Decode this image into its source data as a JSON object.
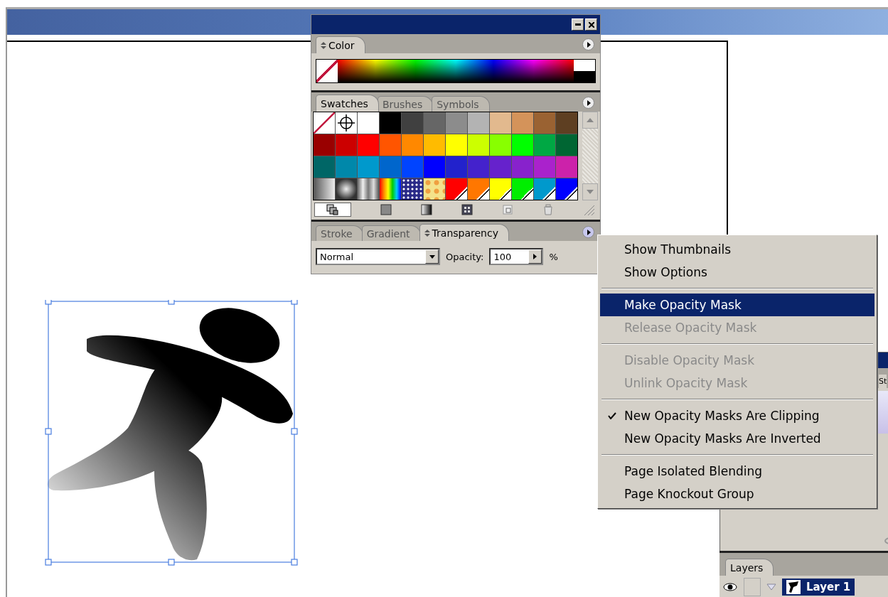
{
  "color_panel": {
    "tabs": [
      {
        "label": "Color",
        "selected": true
      }
    ]
  },
  "swatches_panel": {
    "tabs": [
      {
        "label": "Swatches",
        "selected": true
      },
      {
        "label": "Brushes",
        "selected": false
      },
      {
        "label": "Symbols",
        "selected": false
      }
    ],
    "rows": [
      [
        {
          "kind": "none"
        },
        {
          "kind": "registration"
        },
        {
          "kind": "solid",
          "color": "#ffffff"
        },
        {
          "kind": "solid",
          "color": "#000000"
        },
        {
          "kind": "solid",
          "color": "#404040"
        },
        {
          "kind": "solid",
          "color": "#666666"
        },
        {
          "kind": "solid",
          "color": "#8c8c8c"
        },
        {
          "kind": "solid",
          "color": "#b3b3b3"
        },
        {
          "kind": "solid",
          "color": "#e2b98e"
        },
        {
          "kind": "solid",
          "color": "#d4935a"
        },
        {
          "kind": "solid",
          "color": "#9a6232"
        },
        {
          "kind": "solid",
          "color": "#5e3f22"
        }
      ],
      [
        {
          "kind": "solid",
          "color": "#990000"
        },
        {
          "kind": "solid",
          "color": "#cc0000"
        },
        {
          "kind": "solid",
          "color": "#ff0000"
        },
        {
          "kind": "solid",
          "color": "#ff5500"
        },
        {
          "kind": "solid",
          "color": "#ff8800"
        },
        {
          "kind": "solid",
          "color": "#ffbb00"
        },
        {
          "kind": "solid",
          "color": "#ffff00"
        },
        {
          "kind": "solid",
          "color": "#ccff00"
        },
        {
          "kind": "solid",
          "color": "#88ff00"
        },
        {
          "kind": "solid",
          "color": "#00ff00"
        },
        {
          "kind": "solid",
          "color": "#00a844"
        },
        {
          "kind": "solid",
          "color": "#006633"
        }
      ],
      [
        {
          "kind": "solid",
          "color": "#006666"
        },
        {
          "kind": "solid",
          "color": "#0088aa"
        },
        {
          "kind": "solid",
          "color": "#0099cc"
        },
        {
          "kind": "solid",
          "color": "#0066cc"
        },
        {
          "kind": "solid",
          "color": "#0044ff"
        },
        {
          "kind": "solid",
          "color": "#0000ff"
        },
        {
          "kind": "solid",
          "color": "#2222cc"
        },
        {
          "kind": "solid",
          "color": "#4422cc"
        },
        {
          "kind": "solid",
          "color": "#6622cc"
        },
        {
          "kind": "solid",
          "color": "#8822cc"
        },
        {
          "kind": "solid",
          "color": "#aa22cc"
        },
        {
          "kind": "solid",
          "color": "#cc22aa"
        }
      ],
      [
        {
          "kind": "linear-gradient"
        },
        {
          "kind": "radial-gradient"
        },
        {
          "kind": "metal-gradient"
        },
        {
          "kind": "rainbow-gradient"
        },
        {
          "kind": "star-pattern"
        },
        {
          "kind": "tile-pattern"
        },
        {
          "kind": "spot",
          "color": "#ff0000"
        },
        {
          "kind": "spot",
          "color": "#ff7700"
        },
        {
          "kind": "spot",
          "color": "#ffff00"
        },
        {
          "kind": "spot",
          "color": "#00ee00"
        },
        {
          "kind": "spot",
          "color": "#0099cc"
        },
        {
          "kind": "spot",
          "color": "#0000ff"
        }
      ]
    ]
  },
  "transparency_panel": {
    "tabs": [
      {
        "label": "Stroke",
        "selected": false
      },
      {
        "label": "Gradient",
        "selected": false
      },
      {
        "label": "Transparency",
        "selected": true
      }
    ],
    "blend_mode": "Normal",
    "opacity_label": "Opacity:",
    "opacity": "100",
    "opacity_unit": "%"
  },
  "menu": {
    "sections": [
      [
        {
          "label": "Show Thumbnails",
          "disabled": false,
          "checked": false,
          "selected": false
        },
        {
          "label": "Show Options",
          "disabled": false,
          "checked": false,
          "selected": false
        }
      ],
      [
        {
          "label": "Make Opacity Mask",
          "disabled": false,
          "checked": false,
          "selected": true
        },
        {
          "label": "Release Opacity Mask",
          "disabled": true,
          "checked": false,
          "selected": false
        }
      ],
      [
        {
          "label": "Disable Opacity Mask",
          "disabled": true,
          "checked": false,
          "selected": false
        },
        {
          "label": "Unlink Opacity Mask",
          "disabled": true,
          "checked": false,
          "selected": false
        }
      ],
      [
        {
          "label": "New Opacity Masks Are Clipping",
          "disabled": false,
          "checked": true,
          "selected": false
        },
        {
          "label": "New Opacity Masks Are Inverted",
          "disabled": false,
          "checked": false,
          "selected": false
        }
      ],
      [
        {
          "label": "Page Isolated Blending",
          "disabled": false,
          "checked": false,
          "selected": false
        },
        {
          "label": "Page Knockout Group",
          "disabled": false,
          "checked": false,
          "selected": false
        }
      ]
    ]
  },
  "back_panel": {
    "tab": "St"
  },
  "layers_panel": {
    "tabs": [
      {
        "label": "Layers",
        "selected": true
      }
    ],
    "layers": [
      {
        "name": "Layer 1",
        "selected": true,
        "expanded": true
      }
    ]
  }
}
